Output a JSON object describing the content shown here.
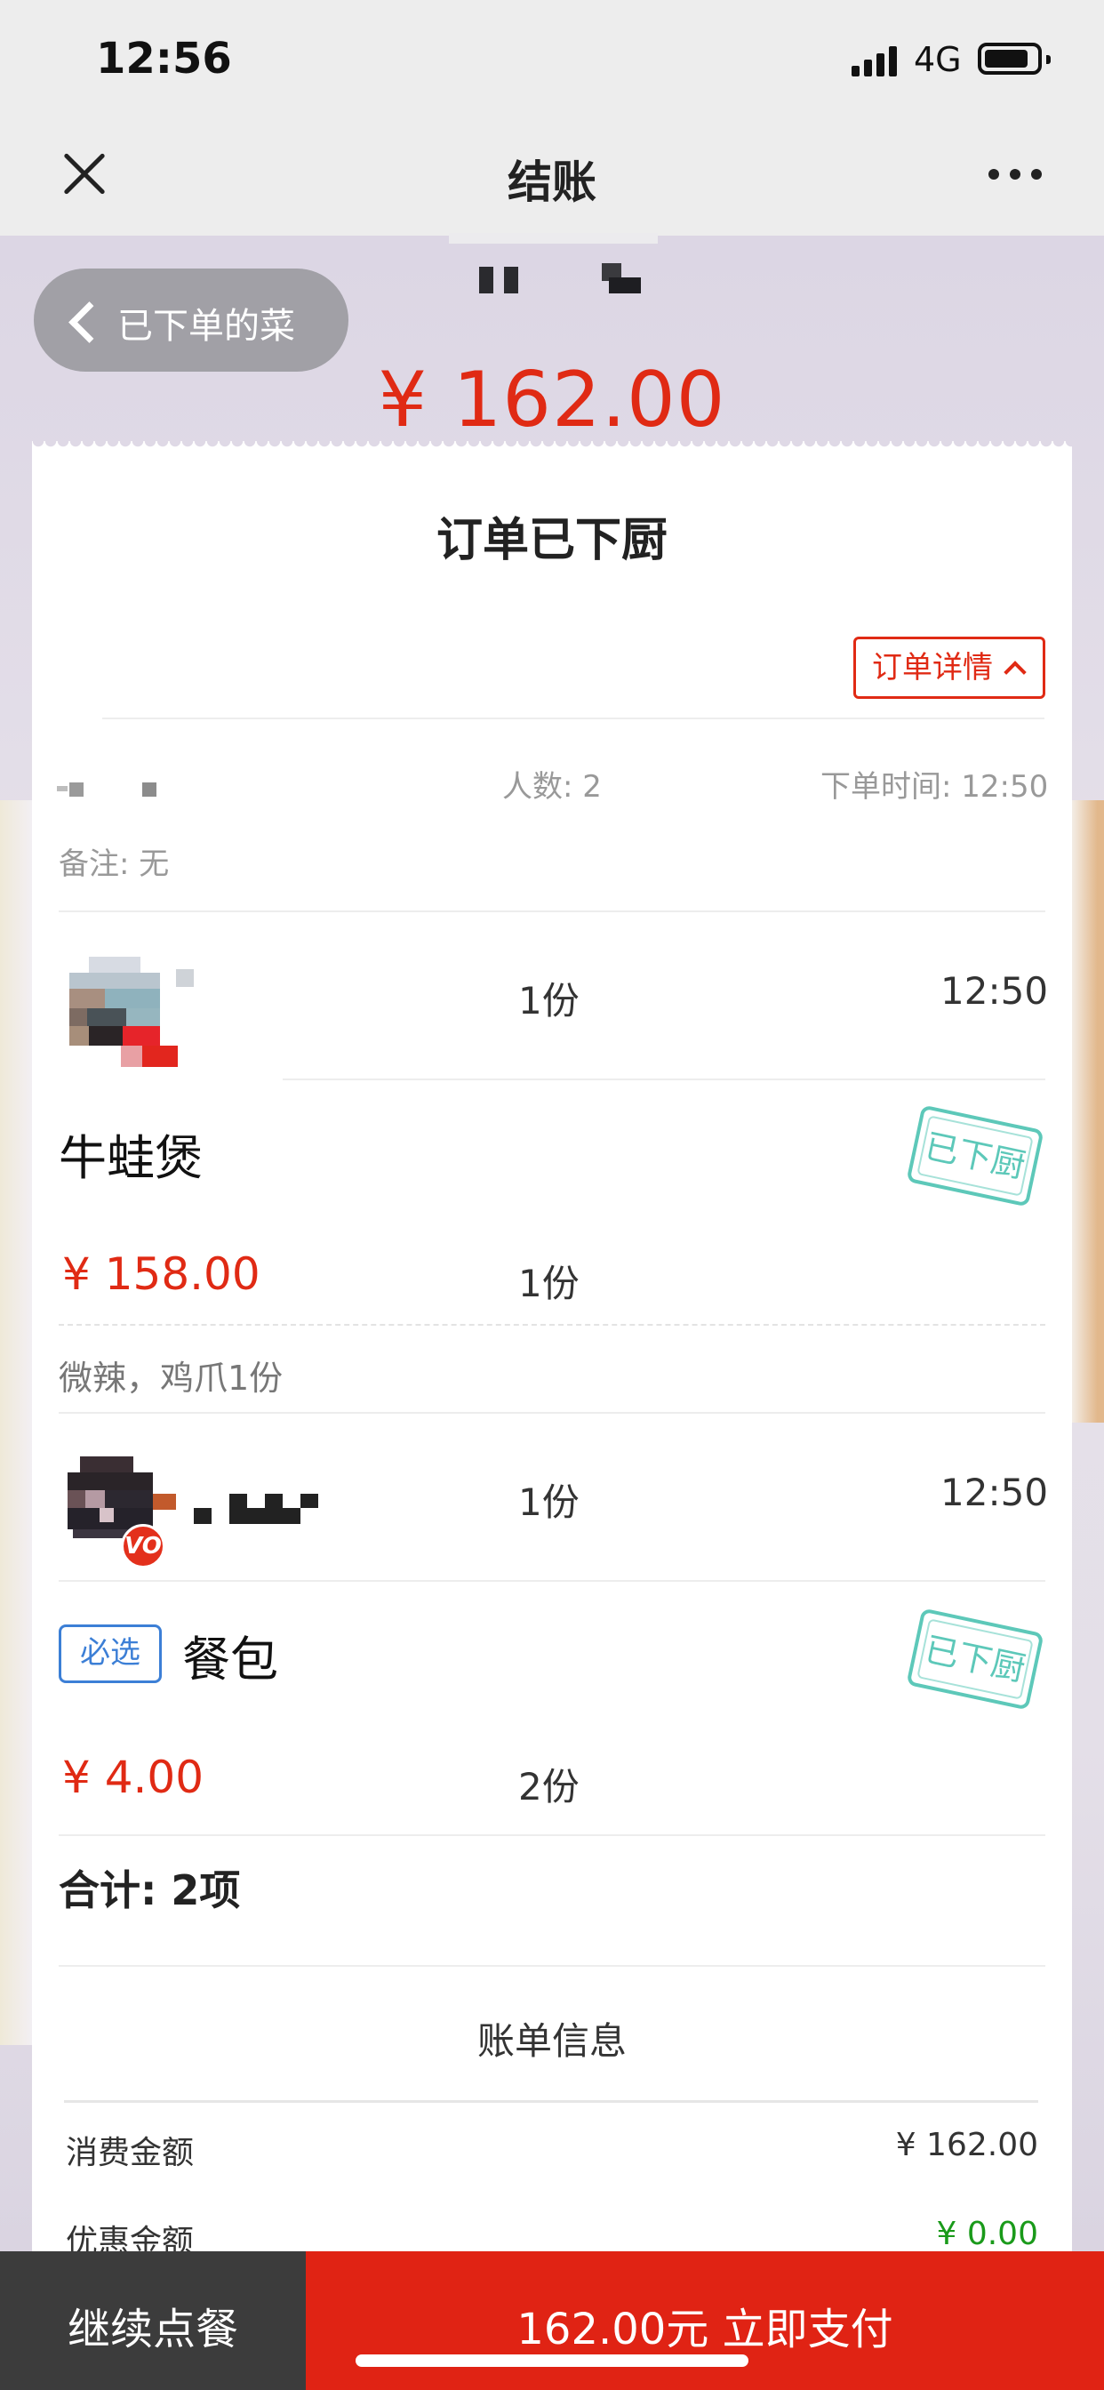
{
  "status_bar": {
    "time": "12:56",
    "network": "4G"
  },
  "nav": {
    "title": "结账"
  },
  "hero": {
    "back_label": "已下单的菜",
    "amount": "¥ 162.00"
  },
  "order": {
    "status": "订单已下厨",
    "detail_button": "订单详情",
    "people": "人数: 2",
    "order_time": "下单时间: 12:50",
    "remark": "备注: 无"
  },
  "items": [
    {
      "qty": "1份",
      "time": "12:50",
      "dish": "牛蛙煲",
      "price": "¥ 158.00",
      "dish_qty": "1份",
      "stamp": "已下厨",
      "note": "微辣，鸡爪1份"
    },
    {
      "qty": "1份",
      "time": "12:50",
      "badge": "VO",
      "tag": "必选",
      "dish": "餐包",
      "price": "¥ 4.00",
      "dish_qty": "2份",
      "stamp": "已下厨"
    }
  ],
  "summary": {
    "total": "合计: 2项"
  },
  "bill": {
    "title": "账单信息",
    "rows": [
      {
        "label": "消费金额",
        "value": "¥ 162.00",
        "color": "#333333"
      },
      {
        "label": "优惠金额",
        "value": "¥ 0.00",
        "color": "#1a9a1a"
      }
    ]
  },
  "bottom_bar": {
    "continue_label": "继续点餐",
    "pay_label": "162.00元 立即支付"
  },
  "colors": {
    "accent_red": "#e02a14",
    "stamp_teal": "#4cc3b2",
    "tag_blue": "#3c7fd6",
    "discount_green": "#1a9a1a"
  }
}
